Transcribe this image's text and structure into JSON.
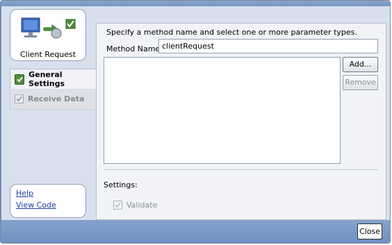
{
  "client": {
    "label": "Client Request"
  },
  "nav": {
    "items": [
      {
        "label": "General Settings"
      },
      {
        "label": "Receive Data"
      }
    ]
  },
  "links": {
    "help": "Help",
    "view_code": "View Code"
  },
  "panel": {
    "instruction": "Specify a method name and select one or more parameter types.",
    "method_label": "Method Name:",
    "method_value": "clientRequest",
    "add_label": "Add...",
    "remove_label": "Remove",
    "settings_label": "Settings:",
    "validate_label": "Validate"
  },
  "footer": {
    "close_label": "Close"
  },
  "colors": {
    "frame_blue": "#6f8fbd",
    "panel_bg": "#f1f3f6",
    "check_green": "#4d8f3a",
    "link": "#1a3fa0"
  },
  "icons": [
    "monitor-icon",
    "arrow-gear-icon",
    "check-icon"
  ]
}
